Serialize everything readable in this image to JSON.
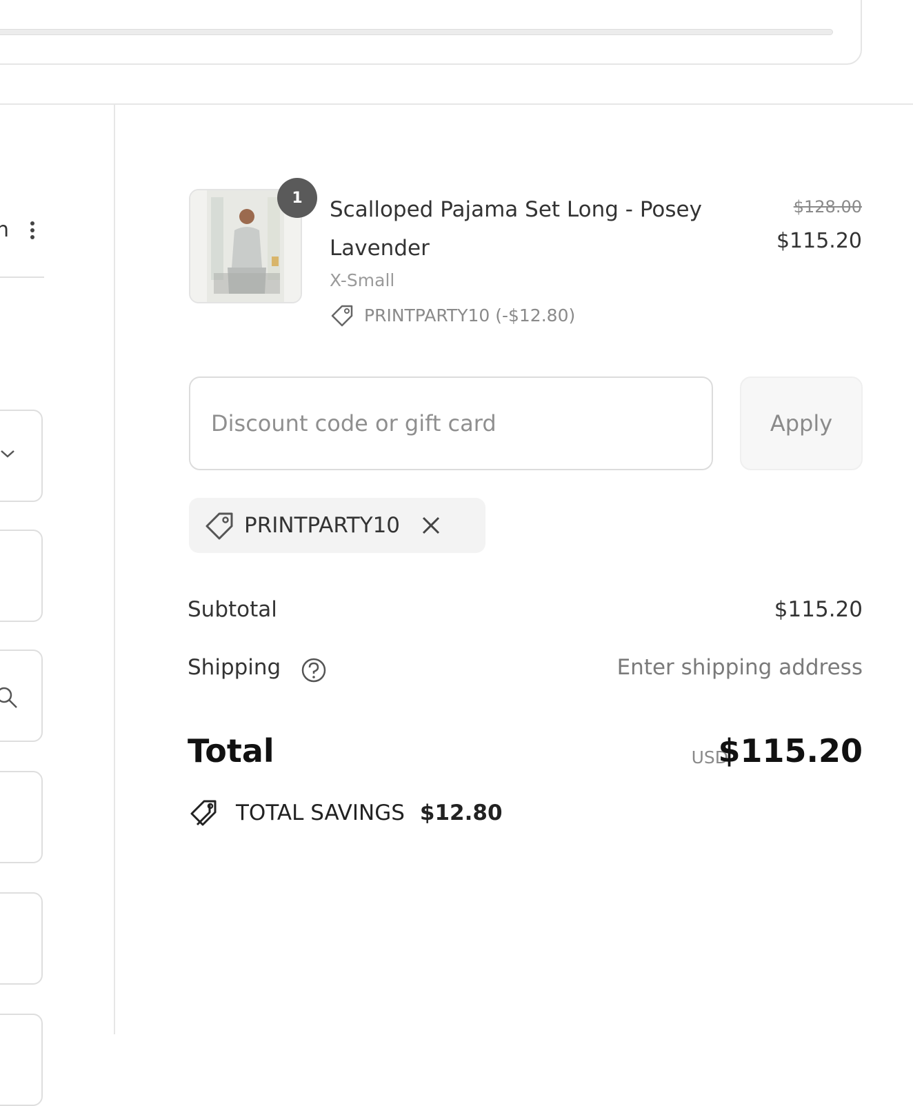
{
  "left_panel": {
    "fragment_text": "n"
  },
  "cart": {
    "item": {
      "quantity": "1",
      "title": "Scalloped Pajama Set Long - Posey Lavender",
      "variant": "X-Small",
      "discount_line": "PRINTPARTY10 (-$12.80)",
      "original_price": "$128.00",
      "price": "$115.20",
      "image_icon": "product-thumbnail"
    },
    "discount": {
      "placeholder": "Discount code or gift card",
      "value": "",
      "apply_label": "Apply"
    },
    "applied_code": {
      "code": "PRINTPARTY10",
      "icon": "tag-icon",
      "remove_icon": "close-icon"
    },
    "summary": {
      "subtotal_label": "Subtotal",
      "subtotal_value": "$115.20",
      "shipping_label": "Shipping",
      "shipping_value": "Enter shipping address",
      "total_label": "Total",
      "currency": "USD",
      "total_value": "$115.20",
      "savings_label": "TOTAL SAVINGS",
      "savings_value": "$12.80"
    }
  },
  "colors": {
    "text": "#333333",
    "muted": "#8a8a8a",
    "border": "#dcdcdc",
    "badge": "#5a5a5a"
  }
}
